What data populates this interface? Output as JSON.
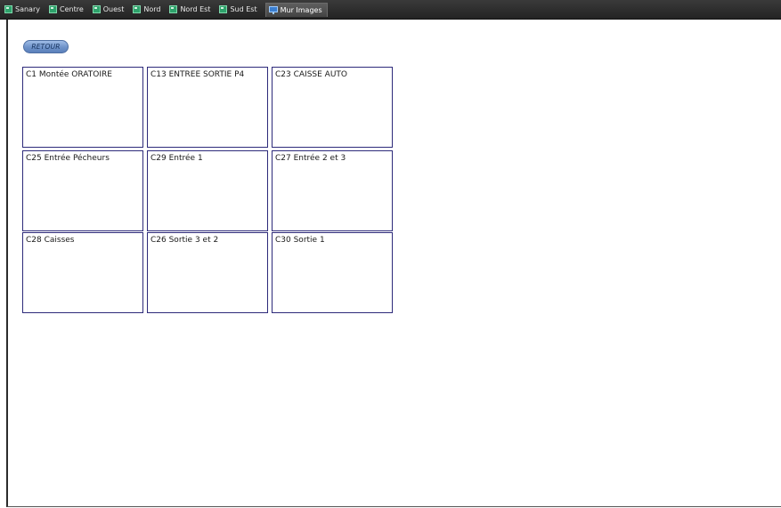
{
  "tabs": [
    {
      "label": "Sanary",
      "icon": "folder-icon"
    },
    {
      "label": "Centre",
      "icon": "folder-icon"
    },
    {
      "label": "Ouest",
      "icon": "folder-icon"
    },
    {
      "label": "Nord",
      "icon": "folder-icon"
    },
    {
      "label": "Nord Est",
      "icon": "folder-icon"
    },
    {
      "label": "Sud Est",
      "icon": "folder-icon"
    },
    {
      "label": "Mur Images",
      "icon": "monitor-icon",
      "active": true
    }
  ],
  "retour_label": "RETOUR",
  "cameras": [
    {
      "label": "C1 Montée ORATOIRE"
    },
    {
      "label": "C13 ENTREE SORTIE P4"
    },
    {
      "label": "C23 CAISSE AUTO"
    },
    {
      "label": "C25 Entrée Pécheurs"
    },
    {
      "label": "C29 Entrée 1"
    },
    {
      "label": "C27 Entrée 2 et 3"
    },
    {
      "label": "C28 Caisses"
    },
    {
      "label": "C26 Sortie 3 et 2"
    },
    {
      "label": "C30 Sortie 1"
    }
  ],
  "colors": {
    "tabbar": "#2b2b2b",
    "cell_border": "#2d2a7a",
    "button_blue": "#6f93c9"
  }
}
